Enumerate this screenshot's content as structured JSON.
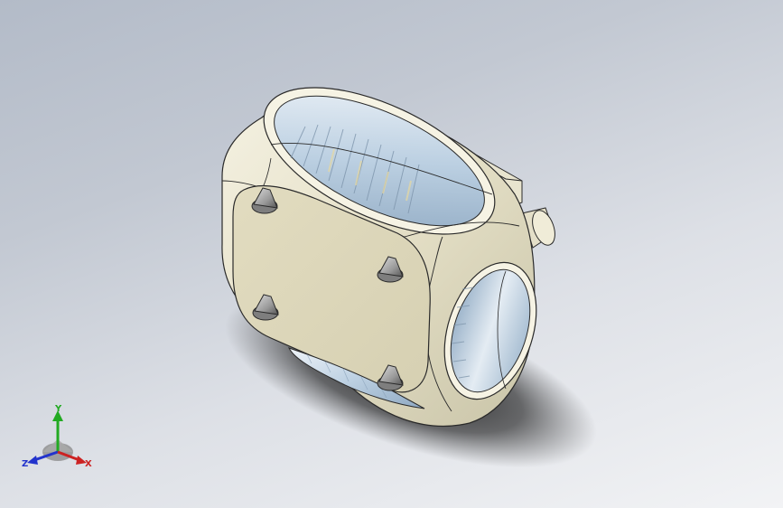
{
  "viewport": {
    "background": "gradient-gray"
  },
  "model": {
    "name": "lamp housing",
    "body_color": "#ece7d1",
    "lens_color": "#c9d9e8",
    "bolt_count": 4
  },
  "triad": {
    "y_label": "Y",
    "z_label": "Z",
    "x_label": "X",
    "y_color": "#22aa22",
    "z_color": "#2233cc",
    "x_color": "#cc2222"
  }
}
